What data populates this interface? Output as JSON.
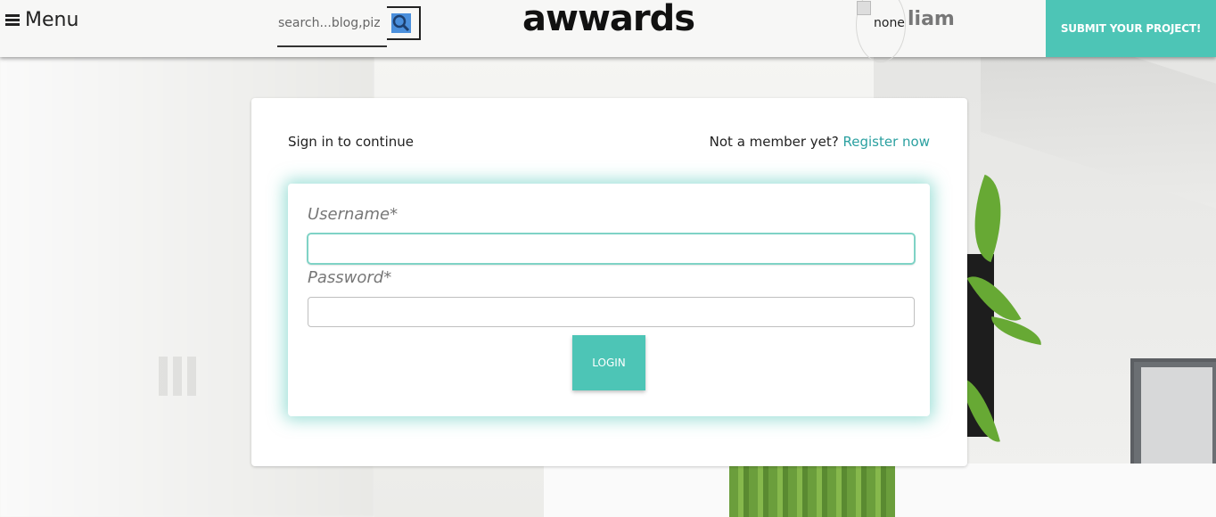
{
  "header": {
    "menu_label": "Menu",
    "search_placeholder": "search...blog,piz",
    "brand": "awwards",
    "avatar_alt": "none",
    "username": "liam",
    "submit_label": "SUBMIT YOUR PROJECT!"
  },
  "login": {
    "signin_text": "Sign in to continue",
    "member_prompt": "Not a member yet?",
    "register_link": "Register now",
    "username_label": "Username*",
    "username_value": "",
    "password_label": "Password*",
    "password_value": "",
    "login_button": "LOGIN"
  },
  "colors": {
    "accent": "#4dc5b6",
    "link": "#2ba0a0",
    "search_icon": "#4a8fdc"
  },
  "icons": {
    "menu": "hamburger-icon",
    "search": "search-icon"
  }
}
